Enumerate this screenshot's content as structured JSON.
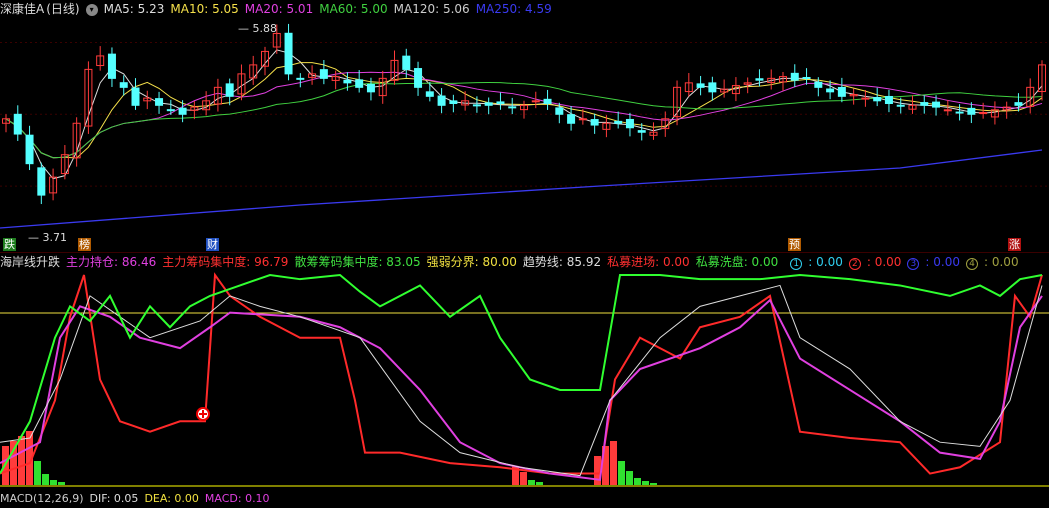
{
  "top_bar": {
    "stock_name": "深康佳A",
    "period": "(日线)",
    "indicators": [
      {
        "label": "MA5: 5.23",
        "color": "#dddddd"
      },
      {
        "label": "MA10: 5.05",
        "color": "#f5e04a"
      },
      {
        "label": "MA20: 5.01",
        "color": "#e040e0"
      },
      {
        "label": "MA60: 5.00",
        "color": "#40d040"
      },
      {
        "label": "MA120: 5.06",
        "color": "#cccccc"
      },
      {
        "label": "MA250: 4.59",
        "color": "#3a3af0"
      }
    ]
  },
  "price_chart": {
    "high_label": "5.88",
    "low_label": "3.71",
    "markers": [
      {
        "text": "跌",
        "bg": "#1e7d1e"
      },
      {
        "text": "榜",
        "bg": "#b05a00"
      },
      {
        "text": "财",
        "bg": "#2050c0"
      },
      {
        "text": "预",
        "bg": "#b05a00"
      },
      {
        "text": "涨",
        "bg": "#b01010"
      }
    ]
  },
  "indicator_bar": {
    "name": "海岸线升跌",
    "fields": [
      {
        "label": "主力持仓: 86.46",
        "color": "#e040e0"
      },
      {
        "label": "主力筹码集中度: 96.79",
        "color": "#ff3030"
      },
      {
        "label": "散筹筹码集中度: 83.05",
        "color": "#40e040"
      },
      {
        "label": "强弱分界: 80.00",
        "color": "#f0e040"
      },
      {
        "label": "趋势线: 85.92",
        "color": "#dddddd"
      },
      {
        "label": "私募进场: 0.00",
        "color": "#ff3030"
      },
      {
        "label": "私募洗盘: 0.00",
        "color": "#40e040"
      }
    ],
    "circles": [
      {
        "num": "1",
        "value": "0.00",
        "color": "#30d0f0"
      },
      {
        "num": "2",
        "value": "0.00",
        "color": "#ff3030"
      },
      {
        "num": "3",
        "value": "0.00",
        "color": "#3a3af0"
      },
      {
        "num": "4",
        "value": "0.00",
        "color": "#a0a040"
      }
    ]
  },
  "bottom_bar": {
    "label": "MACD(12,26,9)",
    "dif": "DIF: 0.05",
    "dea": "DEA: 0.00",
    "macd": "MACD: 0.10"
  },
  "colors": {
    "up": "#ff3b3b",
    "down": "#54ffff",
    "baseline": "#f0e040"
  }
}
